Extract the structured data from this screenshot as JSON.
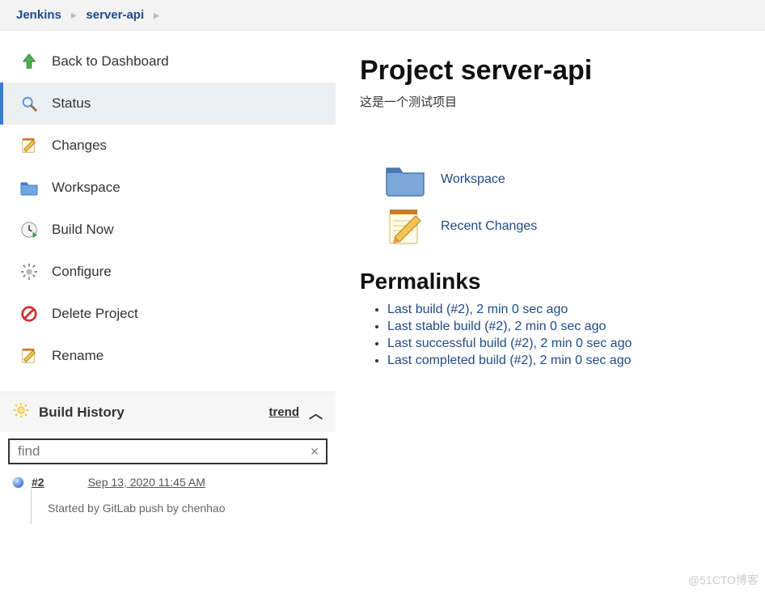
{
  "breadcrumbs": {
    "root": "Jenkins",
    "project": "server-api"
  },
  "sidebar": {
    "items": [
      {
        "label": "Back to Dashboard"
      },
      {
        "label": "Status"
      },
      {
        "label": "Changes"
      },
      {
        "label": "Workspace"
      },
      {
        "label": "Build Now"
      },
      {
        "label": "Configure"
      },
      {
        "label": "Delete Project"
      },
      {
        "label": "Rename"
      }
    ]
  },
  "buildHistory": {
    "title": "Build History",
    "trend_label": "trend",
    "find_placeholder": "find",
    "builds": [
      {
        "number": "#2",
        "time": "Sep 13, 2020 11:45 AM",
        "trigger": "Started by GitLab push by chenhao"
      }
    ]
  },
  "main": {
    "title": "Project server-api",
    "description": "这是一个测试项目",
    "links": {
      "workspace": "Workspace",
      "recent_changes": "Recent Changes"
    },
    "permalinks_heading": "Permalinks",
    "permalinks": [
      "Last build (#2), 2 min 0 sec ago",
      "Last stable build (#2), 2 min 0 sec ago",
      "Last successful build (#2), 2 min 0 sec ago",
      "Last completed build (#2), 2 min 0 sec ago"
    ]
  },
  "watermark": "@51CTO博客"
}
